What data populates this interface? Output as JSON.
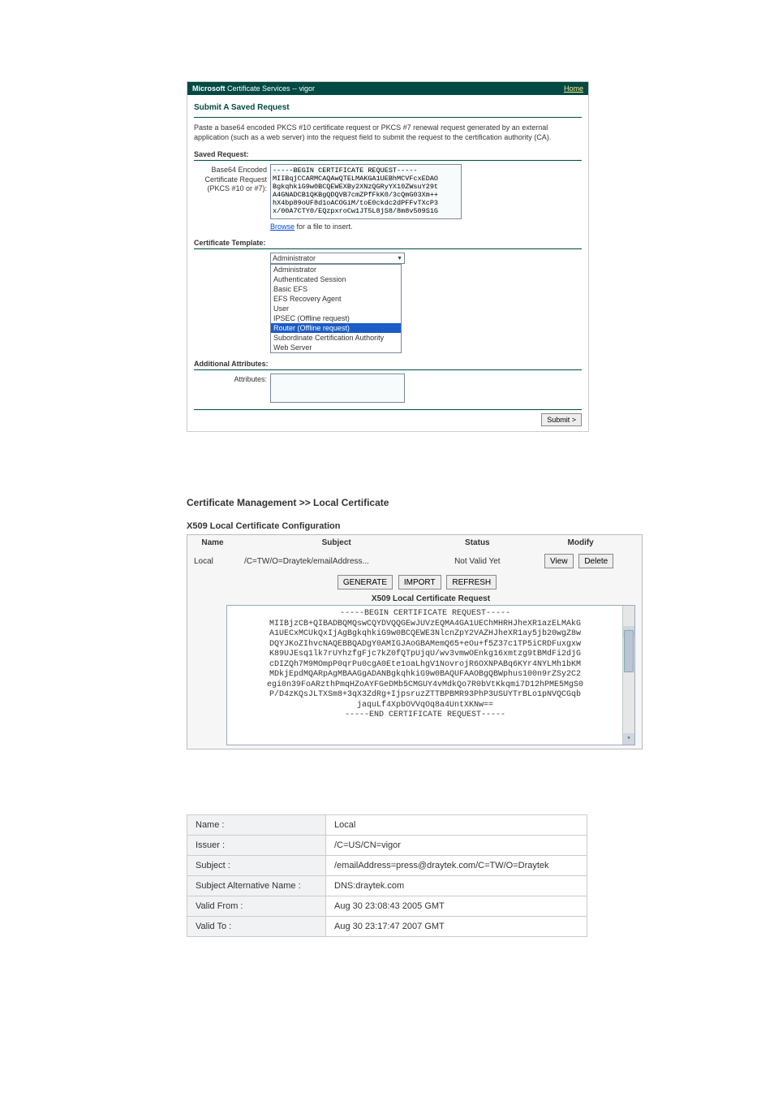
{
  "ms": {
    "brand_prefix_bold": "Microsoft",
    "brand_rest": " Certificate Services  --  vigor",
    "home": "Home",
    "title": "Submit A Saved Request",
    "desc": "Paste a base64 encoded PKCS #10 certificate request or PKCS #7 renewal request generated by an external application (such as a web server) into the request field to submit the request to the certification authority (CA).",
    "saved_label": "Saved Request:",
    "leftcol": "Base64 Encoded\nCertificate Request\n(PKCS #10 or #7):",
    "req_text": "-----BEGIN CERTIFICATE REQUEST-----\nMIIBqjCCARMCAQAwQTELMAKGA1UEBhMCVFcxEDAO\nBgkqhkiG9w0BCQEWEXBy2XNzQGRyYX10ZWsuY29t\nA4GNADCB1QKBgQDQVB7cmZPfFkK0/3cQmG03Xm++\nhX4bp89oUF8d1oACOGiM/toE0ckdc2dPFFvTXcP3\nx/00A7CTY0/EQzpxroCw1JT5L8jS8/8m8v509S1G\n",
    "browse_link": "Browse",
    "browse_after": " for a file to insert.",
    "template_label": "Certificate Template:",
    "selected_template": "Administrator",
    "template_options": [
      "Administrator",
      "Authenticated Session",
      "Basic EFS",
      "EFS Recovery Agent",
      "User",
      "IPSEC (Offline request)",
      "Router (Offline request)",
      "Subordinate Certification Authority",
      "Web Server"
    ],
    "addl_attr_label": "Additional Attributes:",
    "attributes_label": "Attributes:",
    "submit_label": "Submit >"
  },
  "cm": {
    "title": "Certificate Management >> Local Certificate",
    "subtitle": "X509 Local Certificate Configuration",
    "cols": {
      "name": "Name",
      "subject": "Subject",
      "status": "Status",
      "modify": "Modify"
    },
    "row": {
      "name": "Local",
      "subject": "/C=TW/O=Draytek/emailAddress...",
      "status": "Not Valid Yet",
      "view": "View",
      "delete": "Delete"
    },
    "buttons": {
      "generate": "GENERATE",
      "import": "IMPORT",
      "refresh": "REFRESH"
    },
    "req_title": "X509 Local Certificate Request",
    "req_body": "-----BEGIN CERTIFICATE REQUEST-----\nMIIBjzCB+QIBADBQMQswCQYDVQQGEwJUVzEQMA4GA1UEChMHRHJheXR1azELMAkG\nA1UECxMCUkQxIjAgBgkqhkiG9w0BCQEWE3NlcnZpY2VAZHJheXR1ay5jb20wgZ8w\nDQYJKoZIhvcNAQEBBQADgY0AMIGJAoGBAMemQ65+eOu+f5Z37c1TP5iCRDFuxgxw\nK89UJEsq1lk7rUYhzfgFjc7kZ0fQTpUjqU/wv3vmwOEnkg16xmtzg9tBMdFi2djG\ncDIZQh7M9MOmpP0qrPu0cgA0Ete1oaLhgV1NovrojR6OXNPABq6KYr4NYLMh1bKM\nMDkjEpdMQARpAgMBAAGgADANBgkqhkiG9w0BAQUFAAOBgQBWphus100n9rZSy2C2\negi0n39FoARzthPmqHZoAYFGeDMb5CMGUY4vMdkQo7R0bVtKkqmi7D12hPME5MgS0\nP/D4zKQsJLTXSm8+3qX3ZdRg+IjpsruzZTTBPBMR93PhP3USUYTrBLo1pNVQCGqb\njaquLf4XpbOVVqOq8a4UntXKNw==\n-----END CERTIFICATE REQUEST-----"
  },
  "detail": {
    "rows": [
      {
        "k": "Name :",
        "v": "Local"
      },
      {
        "k": "Issuer :",
        "v": "/C=US/CN=vigor"
      },
      {
        "k": "Subject :",
        "v": "/emailAddress=press@draytek.com/C=TW/O=Draytek"
      },
      {
        "k": "Subject Alternative Name :",
        "v": "DNS:draytek.com"
      },
      {
        "k": "Valid From :",
        "v": "Aug 30 23:08:43 2005 GMT"
      },
      {
        "k": "Valid To :",
        "v": "Aug 30 23:17:47 2007 GMT"
      }
    ]
  }
}
